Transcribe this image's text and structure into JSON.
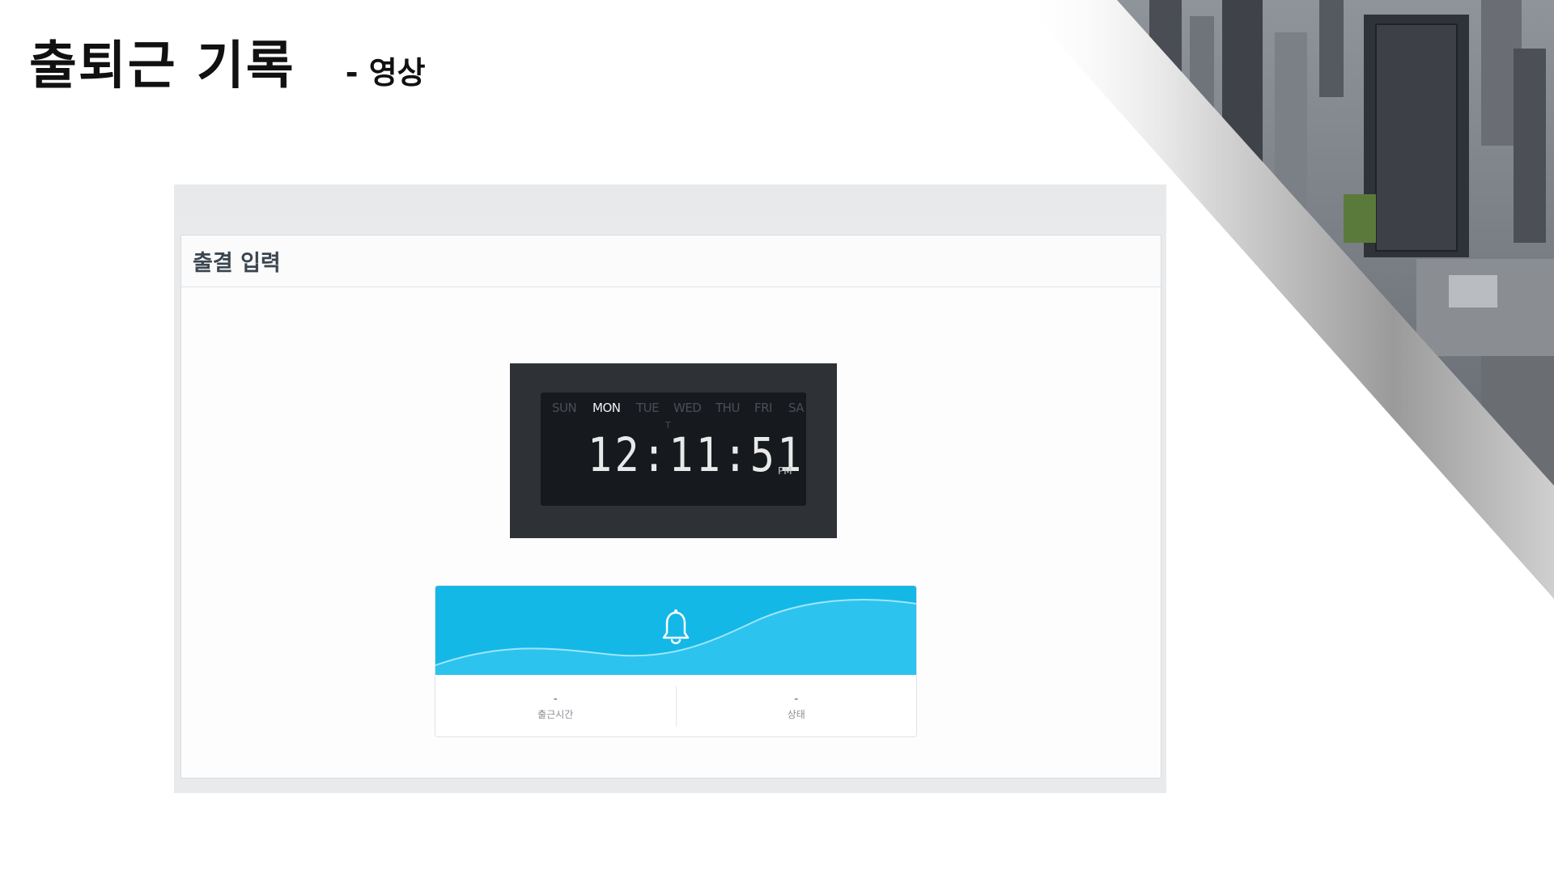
{
  "slide": {
    "title": "출퇴근 기록",
    "subtitle": "- 영상"
  },
  "panel": {
    "title": "출결 입력"
  },
  "clock": {
    "days": [
      "SUN",
      "MON",
      "TUE",
      "WED",
      "THU",
      "FRI",
      "SA"
    ],
    "day_overflow": "T",
    "active_day": "MON",
    "time": "12:11:51",
    "ampm": "PM"
  },
  "attendance": {
    "icon": "bell-icon",
    "checkin_value": "-",
    "checkin_label": "출근시간",
    "status_value": "-",
    "status_label": "상태"
  },
  "colors": {
    "wave_primary": "#14b8e6",
    "wave_secondary": "#3ccaf0",
    "clock_frame": "#2e3136",
    "clock_screen": "#16191d"
  }
}
